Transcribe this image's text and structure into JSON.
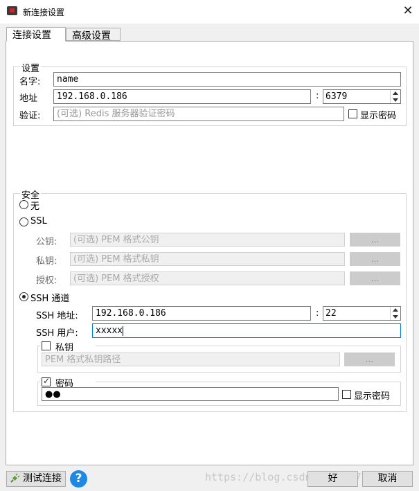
{
  "window": {
    "title": "新连接设置",
    "close_glyph": "✕"
  },
  "tabs": [
    {
      "label": "连接设置",
      "active": true
    },
    {
      "label": "高级设置",
      "active": false
    }
  ],
  "settings": {
    "legend": "设置",
    "name_label": "名字:",
    "name_value": "name",
    "address_label": "地址",
    "host_value": "192.168.0.186",
    "colon": ":",
    "port_value": "6379",
    "auth_label": "验证:",
    "auth_placeholder": "(可选) Redis 服务器验证密码",
    "show_password": "显示密码"
  },
  "security": {
    "legend": "安全",
    "none_label": "无",
    "ssl_label": "SSL",
    "public_key_label": "公钥:",
    "public_key_placeholder": "(可选) PEM 格式公钥",
    "private_key_label": "私钥:",
    "private_key_placeholder": "(可选) PEM 格式私钥",
    "auth_label": "授权:",
    "auth_placeholder": "(可选) PEM 格式授权",
    "browse_label": "...",
    "ssh_label": "SSH 通道",
    "selected": "ssh",
    "ssh_address_label": "SSH 地址:",
    "ssh_host_value": "192.168.0.186",
    "ssh_colon": ":",
    "ssh_port_value": "22",
    "ssh_user_label": "SSH 用户:",
    "ssh_user_value": "xxxxx",
    "private_key_group": {
      "label": "私钥",
      "checked": false,
      "path_placeholder": "PEM 格式私钥路径",
      "browse_label": "..."
    },
    "password_group": {
      "label": "密码",
      "checked": true,
      "masked_value": "●●",
      "show_password": "显示密码"
    }
  },
  "footer": {
    "test_connection": "测试连接",
    "help_glyph": "?",
    "ok": "好",
    "cancel": "取消",
    "watermark": "https://blog.csdn.net/xy7...07"
  },
  "colors": {
    "accent": "#0078d7",
    "help": "#1e88e5",
    "disabled_button": "#cccccc"
  }
}
